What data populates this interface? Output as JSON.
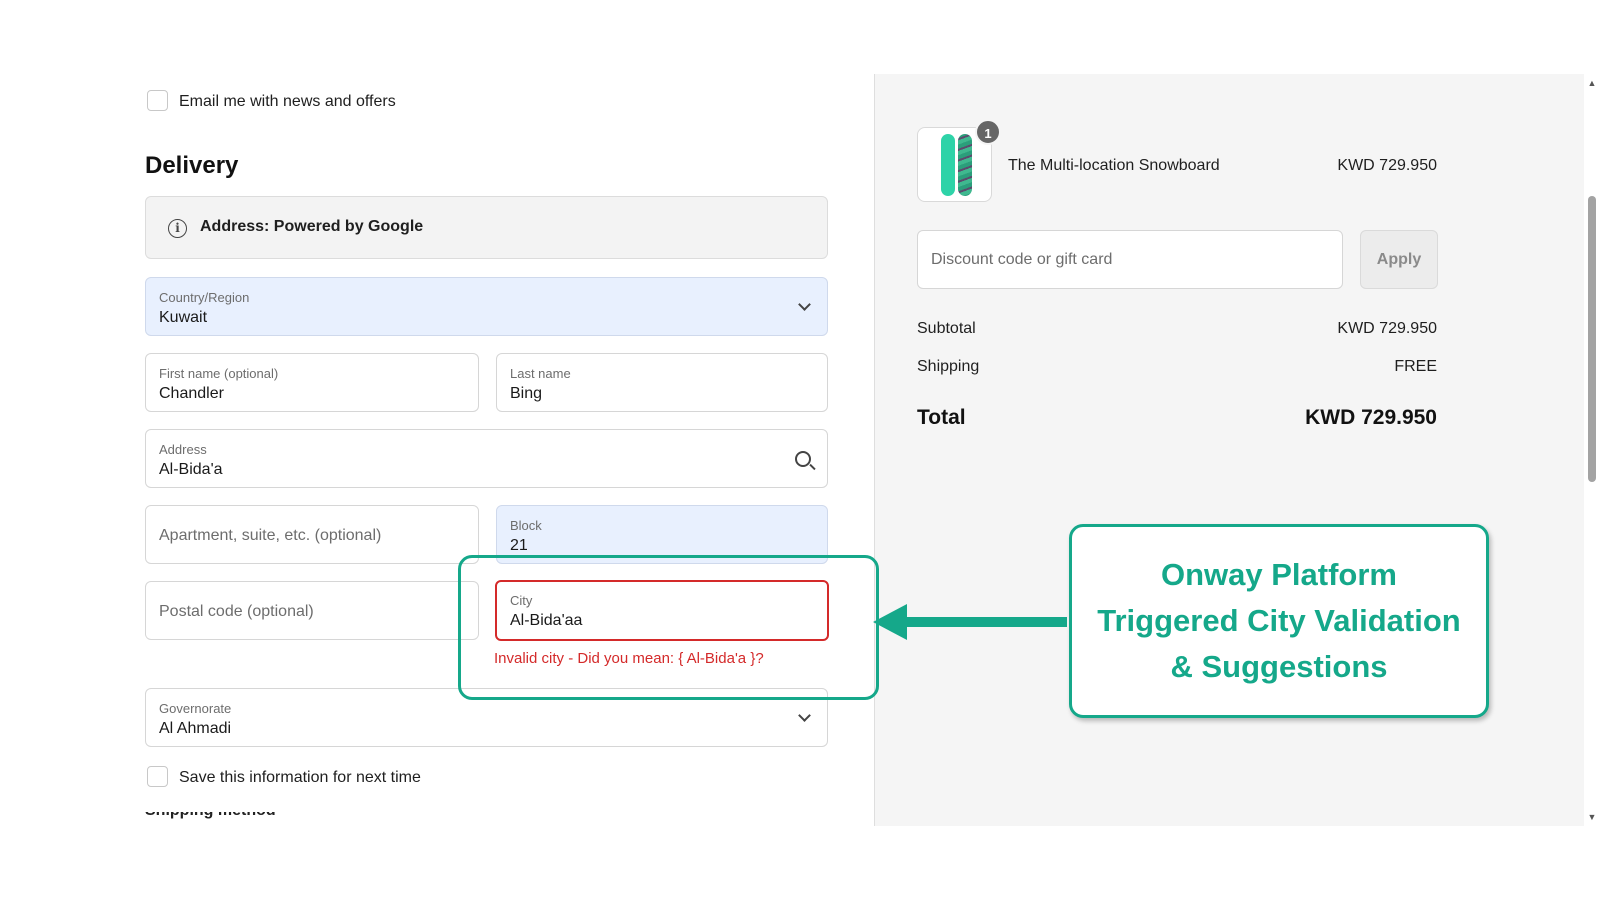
{
  "contact": {
    "email_offers_label": "Email me with news and offers"
  },
  "delivery": {
    "title": "Delivery",
    "address_notice": "Address: Powered by Google",
    "country": {
      "label": "Country/Region",
      "value": "Kuwait"
    },
    "first_name": {
      "label": "First name (optional)",
      "value": "Chandler"
    },
    "last_name": {
      "label": "Last name",
      "value": "Bing"
    },
    "address": {
      "label": "Address",
      "value": "Al-Bida'a"
    },
    "apartment": {
      "placeholder": "Apartment, suite, etc. (optional)"
    },
    "block": {
      "label": "Block",
      "value": "21"
    },
    "postal_code": {
      "placeholder": "Postal code (optional)"
    },
    "city": {
      "label": "City",
      "value": "Al-Bida'aa",
      "error": "Invalid city - Did you mean: { Al-Bida'a }?"
    },
    "governorate": {
      "label": "Governorate",
      "value": "Al Ahmadi"
    },
    "save_info_label": "Save this information for next time",
    "next_section_partial": "Shipping method"
  },
  "summary": {
    "product": {
      "name": "The Multi-location Snowboard",
      "price": "KWD 729.950",
      "quantity": "1"
    },
    "discount_placeholder": "Discount code or gift card",
    "apply_label": "Apply",
    "subtotal_label": "Subtotal",
    "subtotal_value": "KWD 729.950",
    "shipping_label": "Shipping",
    "shipping_value": "FREE",
    "total_label": "Total",
    "total_value": "KWD 729.950"
  },
  "annotation": {
    "lines": [
      "Onway Platform",
      "Triggered City Validation",
      "& Suggestions"
    ],
    "color": "#15a88a"
  },
  "colors": {
    "error": "#d42a2a",
    "autofill": "#e8f0fe"
  }
}
